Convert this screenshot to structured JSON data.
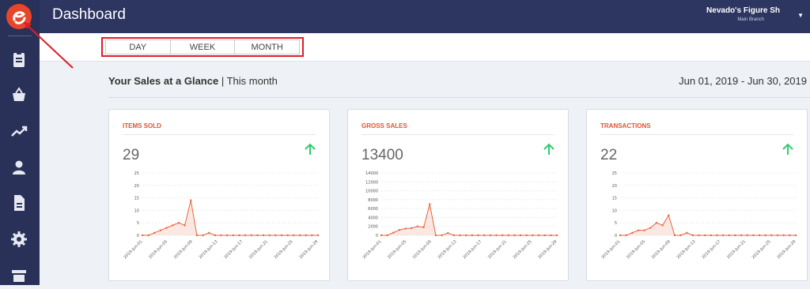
{
  "app": {
    "title": "Dashboard",
    "store_name": "Nevado's Figure Sh",
    "branch": "Main Branch"
  },
  "tabs": [
    "DAY",
    "WEEK",
    "MONTH"
  ],
  "summary": {
    "heading": "Your Sales at a Glance",
    "period": " | This month",
    "date_range": "Jun 01, 2019 - Jun 30, 2019"
  },
  "sidebar_icons": [
    "clipboard-icon",
    "basket-icon",
    "trend-icon",
    "user-icon",
    "document-icon",
    "gear-icon",
    "store-icon"
  ],
  "cards": [
    {
      "title": "ITEMS SOLD",
      "value": "29"
    },
    {
      "title": "GROSS SALES",
      "value": "13400"
    },
    {
      "title": "TRANSACTIONS",
      "value": "22"
    }
  ],
  "chart_data": [
    {
      "type": "area",
      "x_ticks": [
        "2019-Jun-01",
        "2019-Jun-05",
        "2019-Jun-09",
        "2019-Jun-13",
        "2019-Jun-17",
        "2019-Jun-21",
        "2019-Jun-25",
        "2019-Jun-29"
      ],
      "y_ticks": [
        "0",
        "5",
        "10",
        "15",
        "20",
        "25"
      ],
      "ylim": [
        0,
        25
      ],
      "values": [
        0,
        0,
        1,
        2,
        3,
        4,
        5,
        4,
        14,
        0,
        0,
        1,
        0,
        0,
        0,
        0,
        0,
        0,
        0,
        0,
        0,
        0,
        0,
        0,
        0,
        0,
        0,
        0,
        0,
        0
      ],
      "color": "#e8663d"
    },
    {
      "type": "area",
      "x_ticks": [
        "2019-Jun-01",
        "2019-Jun-05",
        "2019-Jun-09",
        "2019-Jun-13",
        "2019-Jun-17",
        "2019-Jun-21",
        "2019-Jun-25",
        "2019-Jun-29"
      ],
      "y_ticks": [
        "0",
        "2000",
        "4000",
        "6000",
        "8000",
        "10000",
        "12000",
        "14000"
      ],
      "ylim": [
        0,
        14000
      ],
      "values": [
        0,
        0,
        600,
        1200,
        1500,
        1600,
        2000,
        1800,
        7000,
        0,
        0,
        500,
        0,
        0,
        0,
        0,
        0,
        0,
        0,
        0,
        0,
        0,
        0,
        0,
        0,
        0,
        0,
        0,
        0,
        0
      ],
      "color": "#e8663d"
    },
    {
      "type": "area",
      "x_ticks": [
        "2019-Jun-01",
        "2019-Jun-05",
        "2019-Jun-09",
        "2019-Jun-13",
        "2019-Jun-17",
        "2019-Jun-21",
        "2019-Jun-25",
        "2019-Jun-29"
      ],
      "y_ticks": [
        "0",
        "5",
        "10",
        "15",
        "20",
        "25"
      ],
      "ylim": [
        0,
        25
      ],
      "values": [
        0,
        0,
        1,
        2,
        2,
        3,
        5,
        4,
        8,
        0,
        0,
        1,
        0,
        0,
        0,
        0,
        0,
        0,
        0,
        0,
        0,
        0,
        0,
        0,
        0,
        0,
        0,
        0,
        0,
        0
      ],
      "color": "#e8663d"
    }
  ],
  "colors": {
    "sidebar": "#2a3159",
    "accent": "#e8462a",
    "positive": "#2ecc71"
  }
}
